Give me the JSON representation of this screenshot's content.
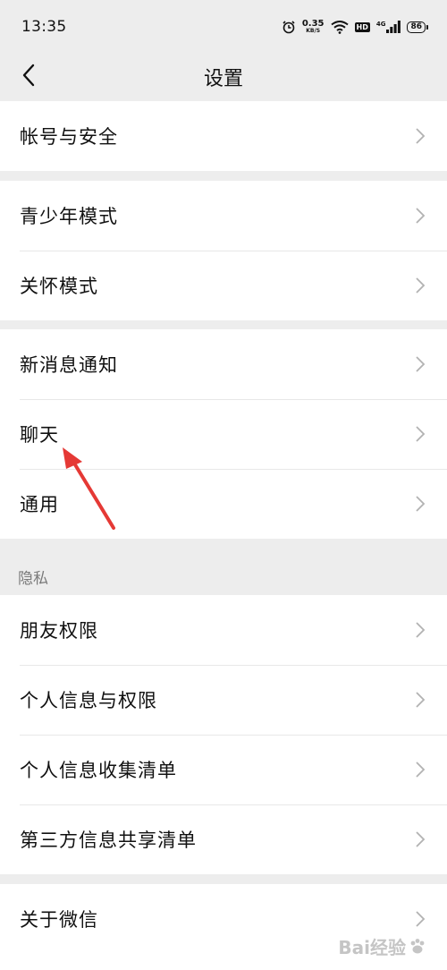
{
  "status_bar": {
    "time": "13:35",
    "net_speed_value": "0.35",
    "net_speed_unit": "KB/S",
    "hd_badge": "HD",
    "network_type": "4G",
    "battery": "86",
    "icons": [
      "alarm-icon",
      "wifi-icon",
      "hd-icon",
      "signal-icon",
      "battery-icon"
    ]
  },
  "nav": {
    "title": "设置",
    "back_icon": "chevron-left-icon"
  },
  "groups": [
    {
      "items": [
        {
          "label": "帐号与安全"
        }
      ]
    },
    {
      "items": [
        {
          "label": "青少年模式"
        },
        {
          "label": "关怀模式"
        }
      ]
    },
    {
      "items": [
        {
          "label": "新消息通知"
        },
        {
          "label": "聊天"
        },
        {
          "label": "通用"
        }
      ]
    },
    {
      "header": "隐私",
      "items": [
        {
          "label": "朋友权限"
        },
        {
          "label": "个人信息与权限"
        },
        {
          "label": "个人信息收集清单"
        },
        {
          "label": "第三方信息共享清单"
        }
      ]
    },
    {
      "items": [
        {
          "label": "关于微信"
        }
      ]
    }
  ],
  "annotation": {
    "type": "red-arrow",
    "target": "聊天",
    "color": "#e53935"
  },
  "watermark": {
    "text": "Bai经验"
  },
  "colors": {
    "background": "#ededed",
    "row_background": "#ffffff",
    "chevron": "#b2b2b2",
    "section_header": "#7a7a7a"
  }
}
